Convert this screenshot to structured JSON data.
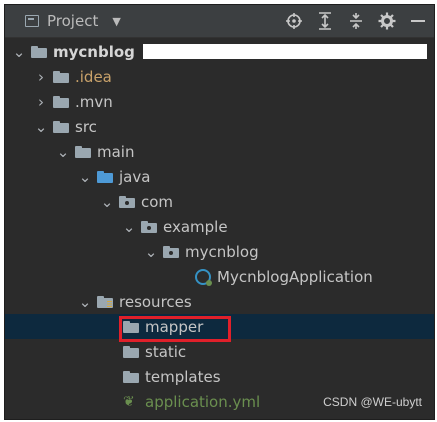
{
  "toolbar": {
    "title": "Project",
    "icons": [
      "locate-icon",
      "expand-all-icon",
      "collapse-all-icon",
      "gear-icon",
      "hide-icon"
    ]
  },
  "tree": {
    "root": "mycnblog",
    "items": {
      "idea": ".idea",
      "mvn": ".mvn",
      "src": "src",
      "main": "main",
      "java": "java",
      "com": "com",
      "example": "example",
      "pkg": "mycnblog",
      "app_class": "MycnblogApplication",
      "resources": "resources",
      "mapper": "mapper",
      "static": "static",
      "templates": "templates",
      "yml": "application.yml"
    },
    "selected": "mapper"
  },
  "colors": {
    "highlight_box": "#e0202a",
    "selection_bg": "#0d293e",
    "folder_blue": "#4e9ad6",
    "folder_gray": "#9aa7b0"
  },
  "watermark": "CSDN @WE-ubytt"
}
